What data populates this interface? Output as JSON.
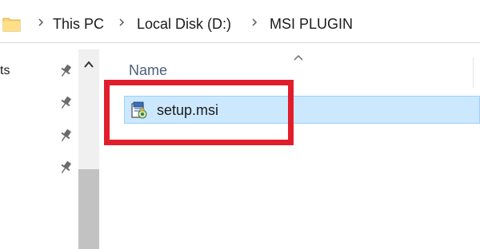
{
  "address_bar": {
    "crumbs": [
      "This PC",
      "Local Disk (D:)",
      "MSI PLUGIN"
    ]
  },
  "nav_pane": {
    "partial_item_text": "ts",
    "pinned_icon": "pin-icon"
  },
  "file_list": {
    "column_header": "Name",
    "sort_indicator": "chevron-up-icon",
    "files": [
      {
        "name": "setup.msi",
        "icon": "msi-installer-icon",
        "selected": true
      }
    ]
  },
  "highlight": {
    "color": "#e21d2b"
  },
  "colors": {
    "selection_bg": "#cce8ff",
    "selection_border": "#99d1ff",
    "header_text": "#4c607a",
    "folder_yellow": "#f8d775"
  }
}
